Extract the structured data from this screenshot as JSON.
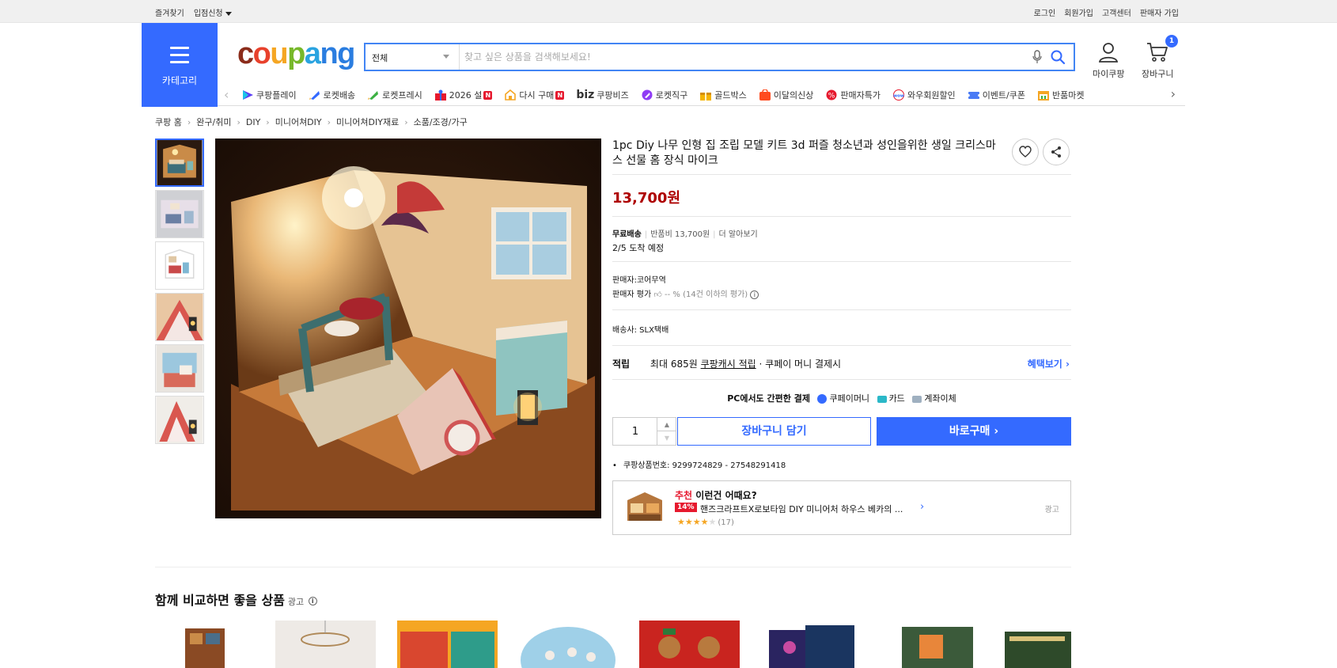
{
  "topbar": {
    "left": [
      "즐겨찾기",
      "입점신청"
    ],
    "right": [
      "로그인",
      "회원가입",
      "고객센터",
      "판매자 가입"
    ]
  },
  "header": {
    "category_label": "카테고리",
    "logo": [
      "c",
      "o",
      "u",
      "p",
      "a",
      "ng"
    ],
    "search": {
      "category": "전체",
      "placeholder": "찾고 싶은 상품을 검색해보세요!"
    },
    "mycoupang": "마이쿠팡",
    "cart": "장바구니",
    "cart_count": "1"
  },
  "nav": {
    "items": [
      {
        "label": "쿠팡플레이",
        "icon": "play-icon"
      },
      {
        "label": "로켓배송",
        "icon": "rocket-icon"
      },
      {
        "label": "로켓프레시",
        "icon": "rocket-fresh-icon"
      },
      {
        "label": "2026 설",
        "icon": "gift-icon",
        "badge": "N"
      },
      {
        "label": "다시 구매",
        "icon": "repurchase-icon",
        "badge": "N"
      },
      {
        "label": "쿠팡비즈",
        "icon": "biz-icon",
        "prefix": "biz"
      },
      {
        "label": "로켓직구",
        "icon": "rocket-global-icon"
      },
      {
        "label": "골드박스",
        "icon": "goldbox-icon"
      },
      {
        "label": "이달의신상",
        "icon": "new-icon"
      },
      {
        "label": "판매자특가",
        "icon": "seller-deal-icon"
      },
      {
        "label": "와우회원할인",
        "icon": "wow-icon"
      },
      {
        "label": "이벤트/쿠폰",
        "icon": "coupon-icon"
      },
      {
        "label": "반품마켓",
        "icon": "return-market-icon"
      }
    ]
  },
  "breadcrumb": [
    "쿠팡 홈",
    "완구/취미",
    "DIY",
    "미니어쳐DIY",
    "미니어쳐DIY재료",
    "소품/조경/가구"
  ],
  "product": {
    "title": "1pc Diy 나무 인형 집 조립 모델 키트 3d 퍼즐 청소년과 성인을위한 생일 크리스마스 선물 홈 장식 마이크",
    "price": "13,700원",
    "shipping": {
      "free": "무료배송",
      "return_fee": "반품비 13,700원",
      "more": "더 알아보기",
      "arrival": "2/5 도착 예정"
    },
    "seller": {
      "name": "판매자:코어무역",
      "rating_label": "판매자 평가",
      "rating_value": "-- %",
      "rating_note": "(14건 이하의 평가)"
    },
    "courier": "배송사:  SLX택배",
    "points": {
      "label": "적립",
      "text_a": "최대 685원",
      "text_b": "쿠팡캐시 적립",
      "text_c": "· 쿠페이 머니 결제시",
      "benefit": "혜택보기"
    },
    "pay": {
      "title": "PC에서도 간편한 결제",
      "method_a": "쿠페이머니",
      "method_b": "카드",
      "method_c": "계좌이체"
    },
    "quantity": "1",
    "cart_button": "장바구니 담기",
    "buy_button": "바로구매",
    "code": "쿠팡상품번호: 9299724829 - 27548291418"
  },
  "recommend": {
    "head_red": "추천",
    "head": "이런건 어때요?",
    "discount": "14%",
    "name": "핸즈크라프트X로보타임 DIY 미니어처 하우스 베카의 ...",
    "stars": "★★★★",
    "half": "★",
    "count": "(17)",
    "ad": "광고"
  },
  "compare": {
    "title": "함께 비교하면 좋을 상품",
    "ad": "광고"
  },
  "colors": {
    "brand_blue": "#346aff",
    "price_red": "#ae0000",
    "badge_red": "#e6192e"
  }
}
